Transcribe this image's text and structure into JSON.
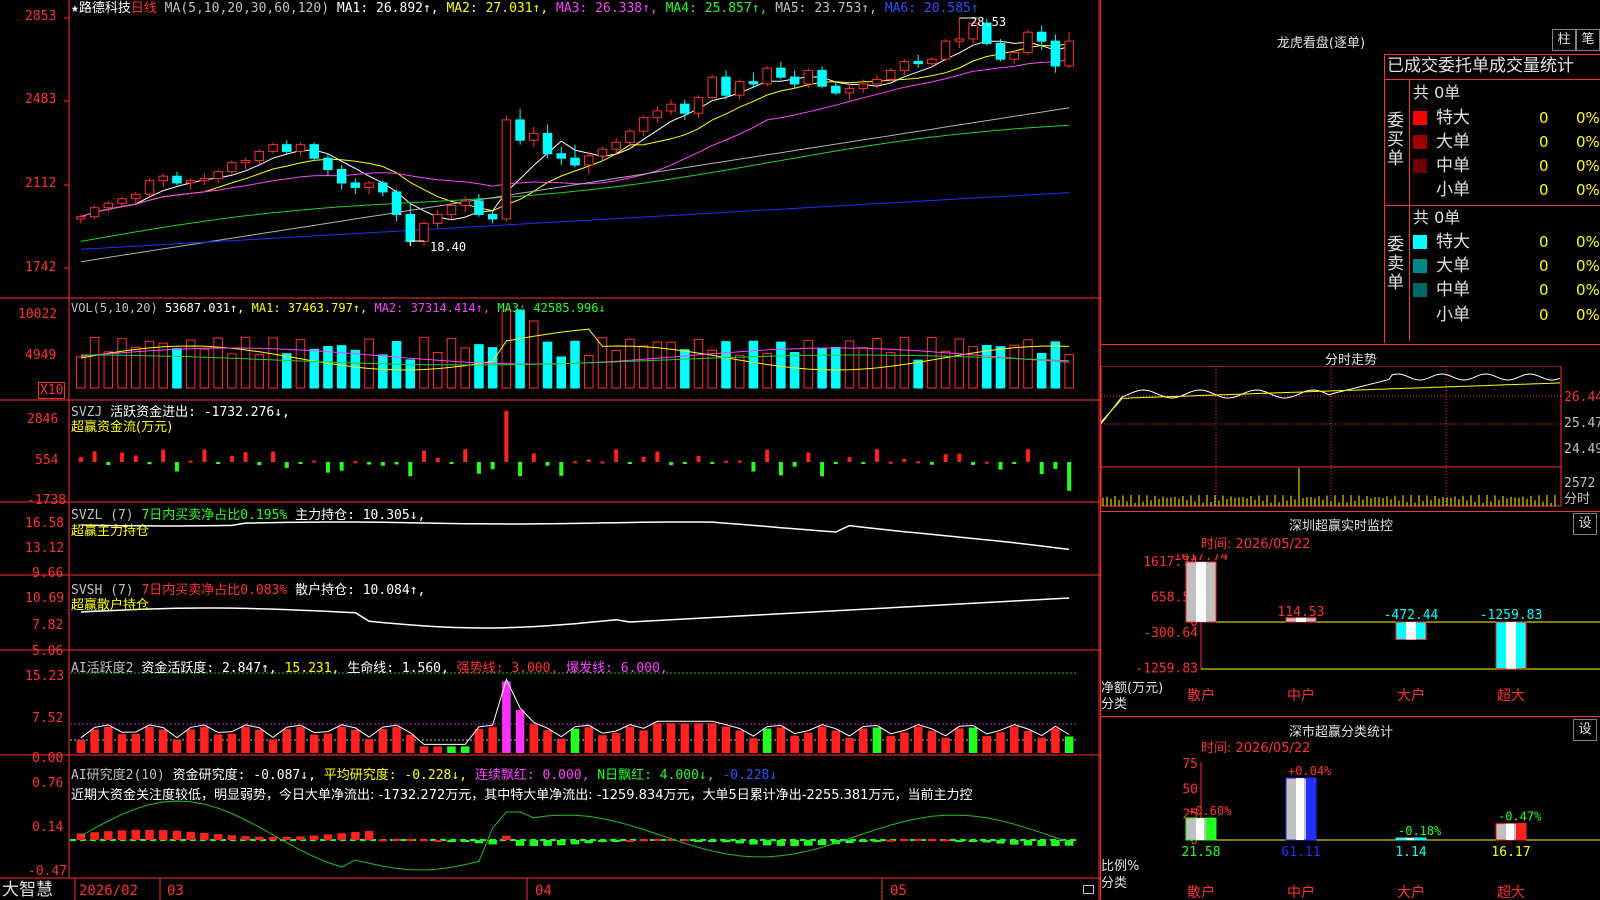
{
  "title_bar": {
    "stock_name": "★路德科技",
    "period": "日线",
    "ma_params": "MA(5,10,20,30,60,120)",
    "ma1": "MA1: 26.892↑,",
    "ma2": "MA2: 27.031↑,",
    "ma3": "MA3: 26.338↑,",
    "ma4": "MA4: 25.857↑,",
    "ma5": "MA5: 23.753↑,",
    "ma6": "MA6: 20.585↑"
  },
  "main_chart": {
    "y_labels": [
      "2853",
      "2483",
      "2112",
      "1742"
    ],
    "high_marker": "28.53",
    "low_marker": "18.40"
  },
  "vol_panel": {
    "header": "VOL(5,10,20)",
    "value": "53687.031↑,",
    "ma1": "MA1: 37463.797↑,",
    "ma2": "MA2: 37314.414↑,",
    "ma3": "MA3: 42585.996↓",
    "y_labels": [
      "10022",
      "4949"
    ],
    "unit": "X10"
  },
  "svzj_panel": {
    "name": "SVZJ",
    "label": "活跃资金进出: -1732.276↓,",
    "sub": "超赢资金流(万元)",
    "y_labels": [
      "2846",
      "554",
      "-1738"
    ]
  },
  "svzl_panel": {
    "name": "SVZL (7)",
    "ratio": "7日内买卖净占比0.195%",
    "hold": "主力持仓: 10.305↓,",
    "sub": "超赢主力持仓",
    "y_labels": [
      "16.58",
      "13.12",
      "9.66"
    ]
  },
  "svsh_panel": {
    "name": "SVSH (7)",
    "ratio": "7日内买卖净占比0.083%",
    "hold": "散户持仓: 10.084↑,",
    "sub": "超赢散户持仓",
    "y_labels": [
      "10.69",
      "7.82",
      "5.06"
    ]
  },
  "ai_activity_panel": {
    "name": "AI活跃度2",
    "activity": "资金活跃度: 2.847↑,",
    "v2": "15.231,",
    "life": "生命线: 1.560,",
    "strong": "强势线: 3.000,",
    "burst": "爆发线: 6.000,",
    "y_labels": [
      "15.23",
      "7.52",
      "0.00"
    ]
  },
  "ai_research_panel": {
    "name": "AI研究度2(10)",
    "research": "资金研究度: -0.087↓,",
    "avg": "平均研究度: -0.228↓,",
    "cont": "连续飘红: 0.000,",
    "nday": "N日飘红: 4.000↓,",
    "last": "-0.228↓",
    "comment": "近期大资金关注度较低，明显弱势，今日大单净流出: -1732.272万元，其中特大单净流出: -1259.834万元，大单5日累计净出-2255.381万元，当前主力控",
    "y_labels": [
      "0.76",
      "0.14",
      "-0.47"
    ]
  },
  "bottom_axis": {
    "brand": "大智慧",
    "year_month": "2026/02",
    "months": [
      "03",
      "04",
      "05"
    ]
  },
  "dragon_tiger": {
    "title": "龙虎看盘(逐单)",
    "btn_bar": "柱",
    "btn_pen": "笔",
    "stats_header": "已成交委托单成交量统计",
    "buy_label": "委买单",
    "sell_label": "委卖单",
    "buy_total": "共 0单",
    "sell_total": "共 0单",
    "buy_rows": [
      {
        "name": "特大",
        "count": "0",
        "pct": "0%"
      },
      {
        "name": "大单",
        "count": "0",
        "pct": "0%"
      },
      {
        "name": "中单",
        "count": "0",
        "pct": "0%"
      },
      {
        "name": "小单",
        "count": "0",
        "pct": "0%"
      }
    ],
    "sell_rows": [
      {
        "name": "特大",
        "count": "0",
        "pct": "0%"
      },
      {
        "name": "大单",
        "count": "0",
        "pct": "0%"
      },
      {
        "name": "中单",
        "count": "0",
        "pct": "0%"
      },
      {
        "name": "小单",
        "count": "0",
        "pct": "0%"
      }
    ]
  },
  "intraday": {
    "title": "分时走势",
    "prices": [
      "26.44",
      "25.47",
      "24.49"
    ],
    "vol": "2572",
    "vol_unit": "分时"
  },
  "sz_monitor": {
    "title": "深圳超赢实时监控",
    "btn": "设",
    "time": "时间: 2026/05/22",
    "y_labels": [
      "1617.74",
      "658.55",
      "0",
      "-300.64",
      "-1259.83"
    ],
    "bars": [
      {
        "cat": "散户",
        "value": 1617.74,
        "label": "1617.74"
      },
      {
        "cat": "中户",
        "value": 114.53,
        "label": "114.53"
      },
      {
        "cat": "大户",
        "value": -472.44,
        "label": "-472.44"
      },
      {
        "cat": "超大",
        "value": -1259.83,
        "label": "-1259.83"
      }
    ],
    "ylabel": "净额(万元)",
    "xlabel": "分类"
  },
  "sz_class": {
    "title": "深市超赢分类统计",
    "btn": "设",
    "time": "时间: 2026/05/22",
    "y_labels": [
      "75",
      "50",
      "25",
      "0"
    ],
    "bars": [
      {
        "cat": "散户",
        "value": 21.58,
        "label": "21.58",
        "change": "+0.60%"
      },
      {
        "cat": "中户",
        "value": 61.11,
        "label": "61.11",
        "change": "+0.04%"
      },
      {
        "cat": "大户",
        "value": 1.14,
        "label": "1.14",
        "change": "-0.18%"
      },
      {
        "cat": "超大",
        "value": 16.17,
        "label": "16.17",
        "change": "-0.47%"
      }
    ],
    "ylabel": "比例%",
    "xlabel": "分类"
  },
  "chart_data": [
    {
      "type": "candlestick",
      "title": "路德科技 日线",
      "ylim": [
        17.42,
        28.53
      ],
      "ohlc": [
        [
          19.6,
          19.8,
          19.4,
          19.7
        ],
        [
          19.7,
          20.2,
          19.6,
          20.1
        ],
        [
          20.1,
          20.4,
          19.9,
          20.3
        ],
        [
          20.3,
          20.6,
          20.1,
          20.5
        ],
        [
          20.5,
          20.8,
          20.3,
          20.7
        ],
        [
          20.7,
          21.4,
          20.6,
          21.3
        ],
        [
          21.3,
          21.6,
          21.0,
          21.5
        ],
        [
          21.5,
          21.7,
          21.1,
          21.2
        ],
        [
          21.2,
          21.4,
          20.9,
          21.3
        ],
        [
          21.3,
          21.6,
          21.1,
          21.4
        ],
        [
          21.4,
          21.8,
          21.2,
          21.7
        ],
        [
          21.7,
          22.2,
          21.6,
          22.1
        ],
        [
          22.1,
          22.3,
          21.8,
          22.2
        ],
        [
          22.2,
          22.7,
          22.0,
          22.6
        ],
        [
          22.6,
          23.0,
          22.5,
          22.9
        ],
        [
          22.9,
          23.1,
          22.5,
          22.6
        ],
        [
          22.6,
          23.0,
          22.4,
          22.9
        ],
        [
          22.9,
          23.0,
          22.2,
          22.3
        ],
        [
          22.3,
          22.5,
          21.5,
          21.8
        ],
        [
          21.8,
          22.0,
          20.9,
          21.2
        ],
        [
          21.2,
          21.4,
          20.7,
          21.0
        ],
        [
          21.0,
          21.3,
          20.7,
          21.2
        ],
        [
          21.2,
          21.3,
          20.6,
          20.8
        ],
        [
          20.8,
          20.9,
          19.5,
          19.8
        ],
        [
          19.8,
          20.3,
          18.4,
          18.6
        ],
        [
          18.6,
          19.5,
          18.4,
          19.4
        ],
        [
          19.4,
          20.0,
          19.2,
          19.8
        ],
        [
          19.8,
          20.3,
          19.6,
          20.2
        ],
        [
          20.2,
          20.6,
          19.9,
          20.4
        ],
        [
          20.4,
          20.7,
          19.7,
          19.8
        ],
        [
          19.8,
          20.0,
          19.4,
          19.6
        ],
        [
          19.6,
          24.2,
          19.5,
          24.0
        ],
        [
          24.0,
          24.5,
          22.9,
          23.1
        ],
        [
          23.1,
          23.7,
          22.8,
          23.4
        ],
        [
          23.4,
          23.8,
          22.3,
          22.5
        ],
        [
          22.5,
          22.8,
          22.0,
          22.3
        ],
        [
          22.3,
          22.9,
          21.9,
          22.0
        ],
        [
          22.0,
          22.6,
          21.6,
          22.4
        ],
        [
          22.4,
          22.8,
          22.2,
          22.7
        ],
        [
          22.7,
          23.2,
          22.5,
          23.0
        ],
        [
          23.0,
          23.6,
          22.8,
          23.5
        ],
        [
          23.5,
          24.2,
          23.3,
          24.1
        ],
        [
          24.1,
          24.6,
          23.9,
          24.4
        ],
        [
          24.4,
          24.9,
          24.2,
          24.7
        ],
        [
          24.7,
          24.9,
          24.0,
          24.3
        ],
        [
          24.3,
          25.1,
          24.1,
          25.0
        ],
        [
          25.0,
          26.0,
          24.9,
          25.9
        ],
        [
          25.9,
          26.2,
          24.9,
          25.1
        ],
        [
          25.1,
          25.8,
          24.9,
          25.7
        ],
        [
          25.7,
          26.1,
          25.4,
          25.6
        ],
        [
          25.6,
          26.4,
          25.5,
          26.3
        ],
        [
          26.3,
          26.6,
          25.8,
          25.9
        ],
        [
          25.9,
          26.2,
          25.4,
          25.6
        ],
        [
          25.6,
          26.3,
          25.4,
          26.2
        ],
        [
          26.2,
          26.4,
          25.4,
          25.5
        ],
        [
          25.5,
          25.7,
          25.1,
          25.2
        ],
        [
          25.2,
          25.6,
          24.9,
          25.4
        ],
        [
          25.4,
          25.8,
          25.2,
          25.6
        ],
        [
          25.6,
          26.0,
          25.4,
          25.8
        ],
        [
          25.8,
          26.3,
          25.7,
          26.2
        ],
        [
          26.2,
          26.7,
          26.0,
          26.6
        ],
        [
          26.6,
          26.9,
          26.3,
          26.5
        ],
        [
          26.5,
          26.8,
          26.3,
          26.7
        ],
        [
          26.7,
          27.6,
          26.6,
          27.5
        ],
        [
          27.5,
          28.53,
          27.2,
          27.6
        ],
        [
          27.6,
          28.4,
          27.4,
          28.3
        ],
        [
          28.3,
          28.5,
          27.3,
          27.4
        ],
        [
          27.4,
          27.6,
          26.6,
          26.7
        ],
        [
          26.7,
          27.1,
          26.5,
          27.0
        ],
        [
          27.0,
          28.0,
          26.9,
          27.9
        ],
        [
          27.9,
          28.2,
          27.1,
          27.5
        ],
        [
          27.5,
          27.8,
          26.1,
          26.4
        ],
        [
          26.4,
          27.9,
          26.3,
          27.5
        ]
      ]
    }
  ]
}
